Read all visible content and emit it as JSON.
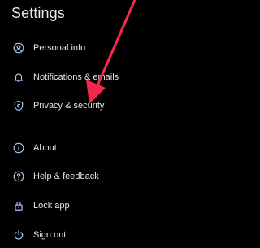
{
  "header": {
    "title": "Settings"
  },
  "section_primary": {
    "items": [
      {
        "label": "Personal info",
        "icon": "account-circle-icon"
      },
      {
        "label": "Notifications & emails",
        "icon": "bell-icon"
      },
      {
        "label": "Privacy & security",
        "icon": "shield-icon"
      }
    ]
  },
  "section_secondary": {
    "items": [
      {
        "label": "About",
        "icon": "info-icon"
      },
      {
        "label": "Help & feedback",
        "icon": "help-icon"
      },
      {
        "label": "Lock app",
        "icon": "lock-icon"
      },
      {
        "label": "Sign out",
        "icon": "power-icon"
      }
    ]
  },
  "colors": {
    "background": "#000000",
    "text": "#e3e5e8",
    "icon": "#a8c7fa",
    "divider": "#3a3c40",
    "annotation_arrow": "#f2294b"
  }
}
